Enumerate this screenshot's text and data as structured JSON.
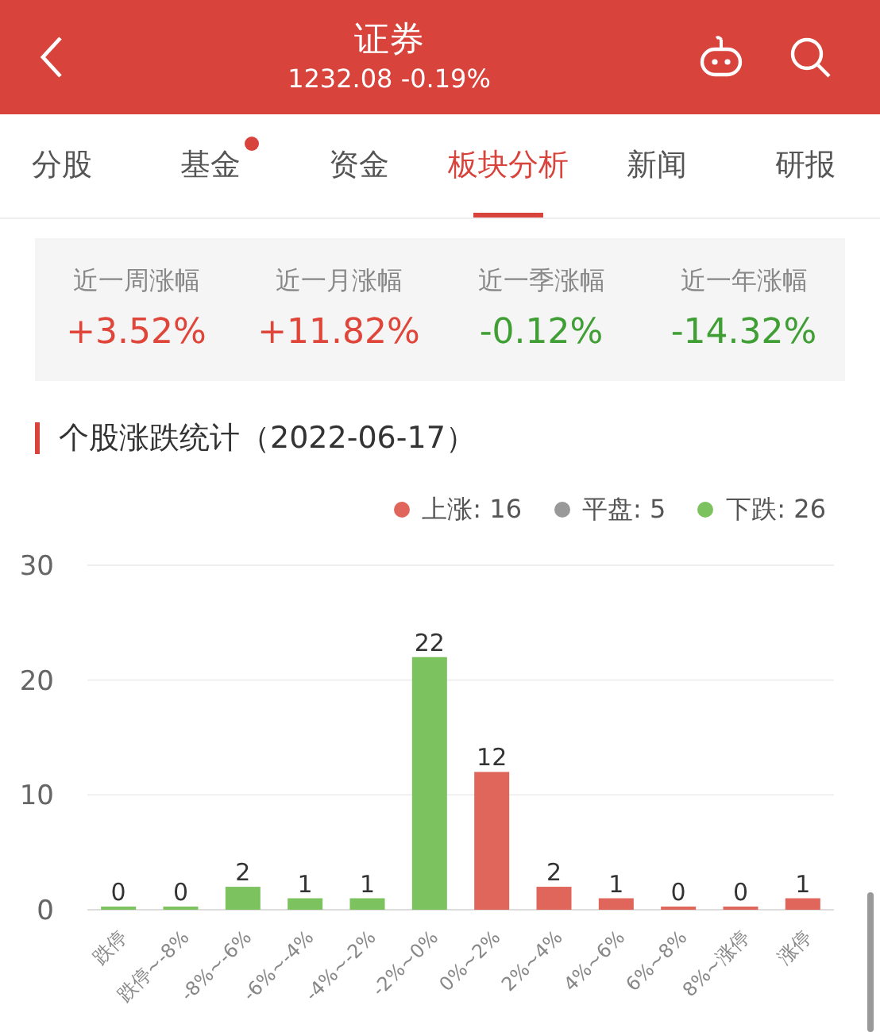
{
  "header": {
    "title": "证券",
    "quote": "1232.08 -0.19%"
  },
  "tabs": [
    {
      "label": "分股",
      "selected": false,
      "badge": false
    },
    {
      "label": "基金",
      "selected": false,
      "badge": true
    },
    {
      "label": "资金",
      "selected": false,
      "badge": false
    },
    {
      "label": "板块分析",
      "selected": true,
      "badge": false
    },
    {
      "label": "新闻",
      "selected": false,
      "badge": false
    },
    {
      "label": "研报",
      "selected": false,
      "badge": false
    }
  ],
  "stats": [
    {
      "label": "近一周涨幅",
      "value": "+3.52%",
      "rising": true
    },
    {
      "label": "近一月涨幅",
      "value": "+11.82%",
      "rising": true
    },
    {
      "label": "近一季涨幅",
      "value": "-0.12%",
      "rising": false
    },
    {
      "label": "近一年涨幅",
      "value": "-14.32%",
      "rising": false
    }
  ],
  "section": {
    "title": "个股涨跌统计（2022-06-17）"
  },
  "legend": [
    {
      "label": "上涨: 16",
      "color": "#e0665c"
    },
    {
      "label": "平盘: 5",
      "color": "#999999"
    },
    {
      "label": "下跌: 26",
      "color": "#7cc35f"
    }
  ],
  "chart_data": {
    "type": "bar",
    "categories": [
      "跌停",
      "跌停~-8%",
      "-8%~-6%",
      "-6%~-4%",
      "-4%~-2%",
      "-2%~0%",
      "0%~2%",
      "2%~4%",
      "4%~6%",
      "6%~8%",
      "8%~涨停",
      "涨停"
    ],
    "series": [
      {
        "color": "#7cc35f",
        "values": [
          0,
          0,
          2,
          1,
          1,
          22,
          null,
          null,
          null,
          null,
          null,
          null
        ]
      },
      {
        "color": "#e0665c",
        "values": [
          null,
          null,
          null,
          null,
          null,
          null,
          12,
          2,
          1,
          0,
          0,
          1
        ]
      }
    ],
    "ylim": [
      0,
      30
    ],
    "yticks": [
      0,
      10,
      20,
      30
    ],
    "data_labels": true
  }
}
